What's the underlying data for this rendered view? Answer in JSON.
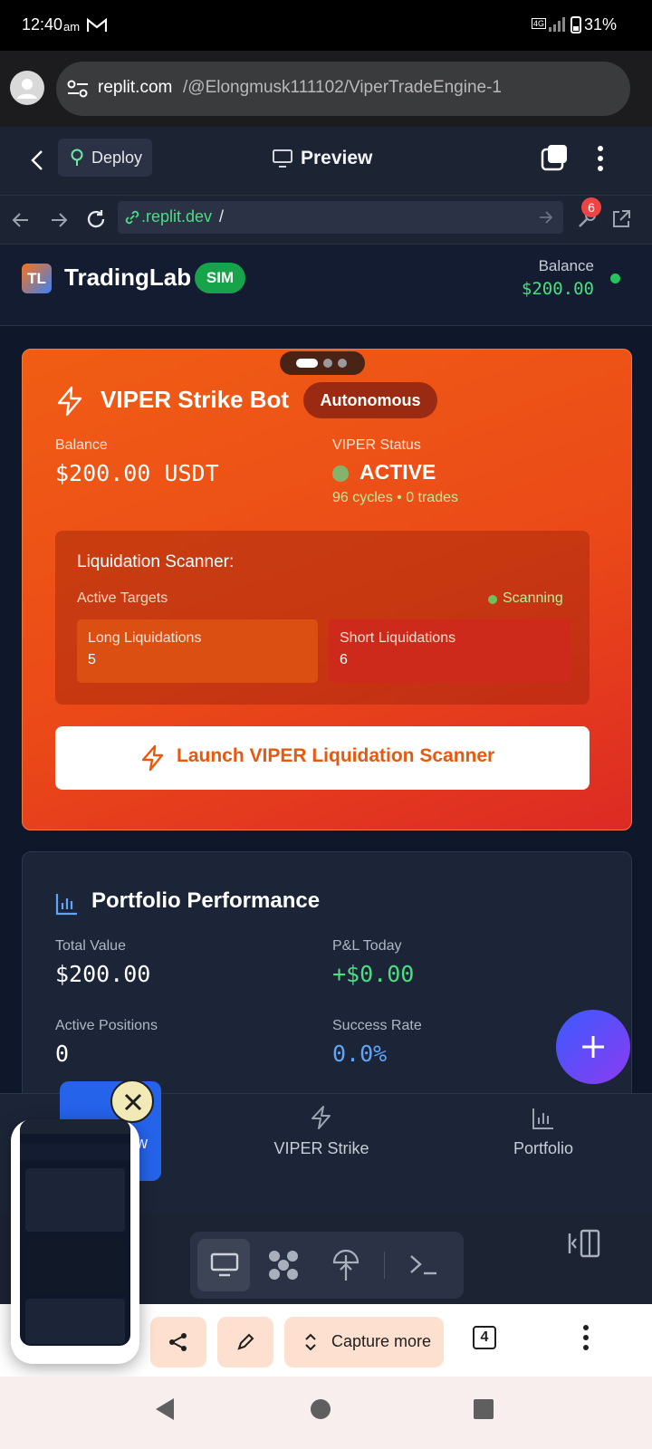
{
  "status_bar": {
    "time": "12:40",
    "ampm": "am",
    "network": "4G",
    "battery": "31%"
  },
  "browser": {
    "url_domain": "replit.com",
    "url_path": "/@Elongmusk111102/ViperTradeEngine-1"
  },
  "replit_header": {
    "deploy_label": "Deploy",
    "preview_label": "Preview"
  },
  "replit_nav": {
    "url_domain": ".replit.dev",
    "url_path": "/",
    "badge_count": "6"
  },
  "app": {
    "logo_initials": "TL",
    "name": "TradingLab",
    "mode_badge": "SIM",
    "balance_label": "Balance",
    "balance_value": "$200.00"
  },
  "viper": {
    "title": "VIPER Strike Bot",
    "badge": "Autonomous",
    "balance_label": "Balance",
    "balance_value": "$200.00 USDT",
    "status_label": "VIPER Status",
    "status_value": "ACTIVE",
    "cycles_text": "96 cycles • 0 trades",
    "scanner_title": "Liquidation Scanner:",
    "active_targets_label": "Active Targets",
    "scanning_label": "Scanning",
    "long_label": "Long Liquidations",
    "long_value": "5",
    "short_label": "Short Liquidations",
    "short_value": "6",
    "launch_label": "Launch VIPER Liquidation Scanner"
  },
  "portfolio": {
    "title": "Portfolio Performance",
    "total_value_label": "Total Value",
    "total_value": "$200.00",
    "pnl_label": "P&L Today",
    "pnl_value": "+$0.00",
    "positions_label": "Active Positions",
    "positions_value": "0",
    "success_label": "Success Rate",
    "success_value": "0.0%"
  },
  "bottom_nav": {
    "items": [
      {
        "label": "w"
      },
      {
        "label": "VIPER Strike"
      },
      {
        "label": "Portfolio"
      }
    ]
  },
  "screenshot_bar": {
    "capture_more_label": "Capture more",
    "tab_count": "4"
  },
  "colors": {
    "accent_green": "#22c55e",
    "viper_orange": "#f05d14",
    "blue": "#60a5fa"
  }
}
